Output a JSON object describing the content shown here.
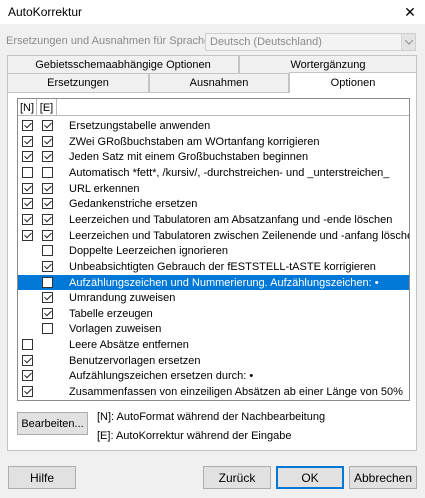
{
  "window": {
    "title": "AutoKorrektur",
    "close_glyph": "✕"
  },
  "language": {
    "label": "Ersetzungen und Ausnahmen für Sprache:",
    "value": "Deutsch (Deutschland)"
  },
  "tabs": [
    {
      "label": "Gebietsschemaabhängige Optionen",
      "active": false
    },
    {
      "label": "Wortergänzung",
      "active": false
    },
    {
      "label": "Ersetzungen",
      "active": false
    },
    {
      "label": "Ausnahmen",
      "active": false
    },
    {
      "label": "Optionen",
      "active": true
    }
  ],
  "list": {
    "headers": [
      "[N]",
      "[E]"
    ],
    "rows": [
      {
        "label": "Ersetzungstabelle anwenden",
        "n": true,
        "e": true
      },
      {
        "label": "ZWei GRoßbuchstaben am WOrtanfang korrigieren",
        "n": true,
        "e": true
      },
      {
        "label": "Jeden Satz mit einem Großbuchstaben beginnen",
        "n": true,
        "e": true
      },
      {
        "label": "Automatisch *fett*, /kursiv/, -durchstreichen- und _unterstreichen_",
        "n": false,
        "e": false
      },
      {
        "label": "URL erkennen",
        "n": true,
        "e": true
      },
      {
        "label": "Gedankenstriche ersetzen",
        "n": true,
        "e": true
      },
      {
        "label": "Leerzeichen und Tabulatoren am Absatzanfang und -ende löschen",
        "n": true,
        "e": true
      },
      {
        "label": "Leerzeichen und Tabulatoren zwischen Zeilenende und -anfang löschen",
        "n": true,
        "e": true
      },
      {
        "label": "Doppelte Leerzeichen ignorieren",
        "n": null,
        "e": false
      },
      {
        "label": "Unbeabsichtigten Gebrauch der fESTSTELL-tASTE korrigieren",
        "n": null,
        "e": true
      },
      {
        "label": "Aufzählungszeichen und Nummerierung. Aufzählungszeichen: •",
        "n": null,
        "e": false,
        "selected": true
      },
      {
        "label": "Umrandung zuweisen",
        "n": null,
        "e": true
      },
      {
        "label": "Tabelle erzeugen",
        "n": null,
        "e": true
      },
      {
        "label": "Vorlagen zuweisen",
        "n": null,
        "e": false
      },
      {
        "label": "Leere Absätze entfernen",
        "n": false,
        "e": null
      },
      {
        "label": "Benutzervorlagen ersetzen",
        "n": true,
        "e": null
      },
      {
        "label": "Aufzählungszeichen ersetzen durch: •",
        "n": true,
        "e": null
      },
      {
        "label": "Zusammenfassen von einzeiligen Absätzen ab einer Länge von 50%",
        "n": true,
        "e": null
      }
    ]
  },
  "edit_button": "Bearbeiten...",
  "legend": {
    "n": "[N]: AutoFormat während der Nachbearbeitung",
    "e": "[E]: AutoKorrektur während der Eingabe"
  },
  "buttons": {
    "help": "Hilfe",
    "back": "Zurück",
    "ok": "OK",
    "cancel": "Abbrechen"
  }
}
